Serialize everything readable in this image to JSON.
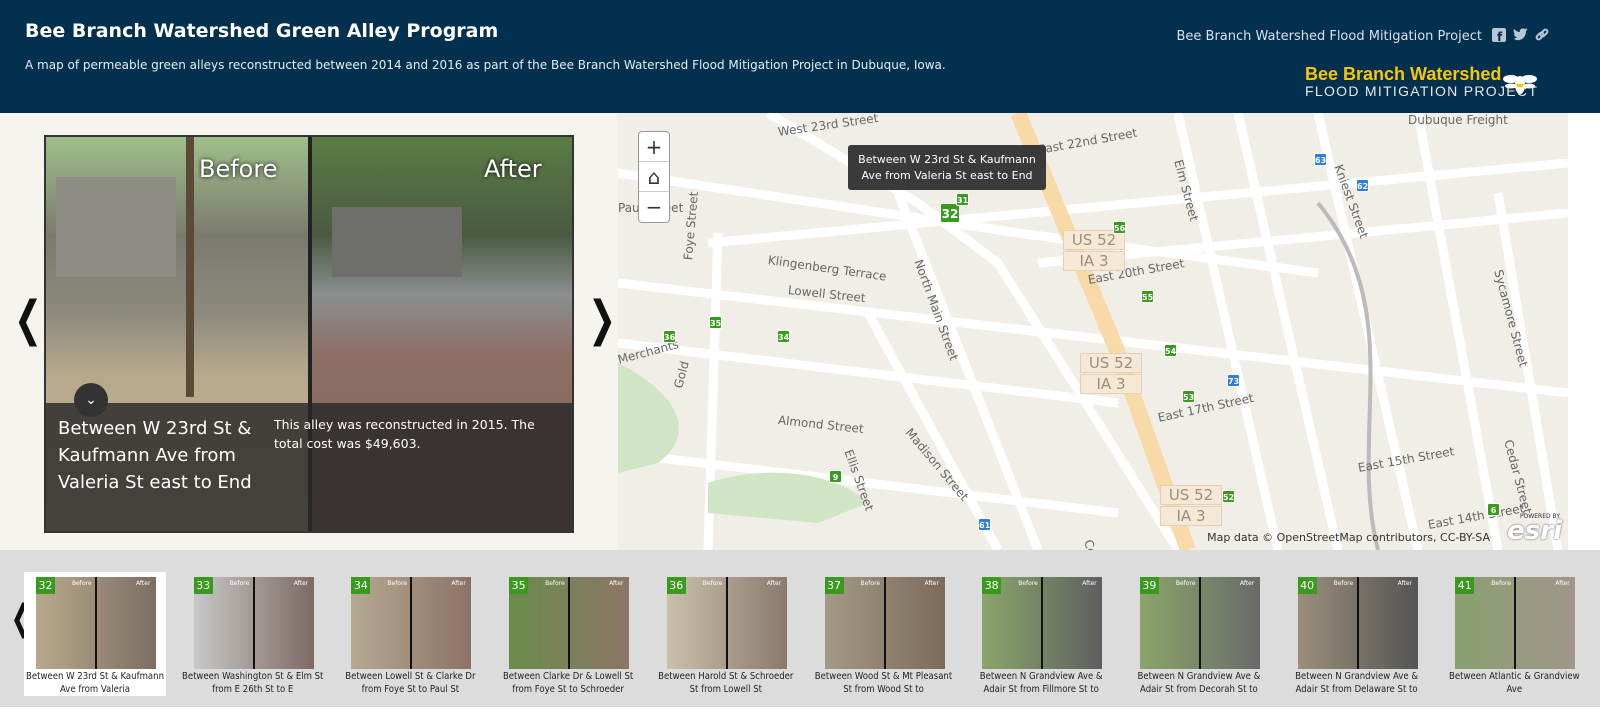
{
  "header": {
    "title": "Bee Branch Watershed Green Alley Program",
    "subtitle": "A map of permeable green alleys reconstructed between 2014 and 2016 as part of the Bee Branch Watershed Flood Mitigation Project in Dubuque, Iowa.",
    "link": "Bee Branch Watershed Flood Mitigation Project",
    "social": [
      "facebook-icon",
      "twitter-icon",
      "link-icon"
    ],
    "logo_line1": "Bee Branch Watershed",
    "logo_line2": "FLOOD MITIGATION PROJECT"
  },
  "feature": {
    "before_label": "Before",
    "after_label": "After",
    "title": "Between W 23rd St & Kaufmann Ave from Valeria St east to End",
    "description": "This alley was reconstructed in 2015. The total cost was $49,603."
  },
  "map": {
    "zoom_in": "+",
    "home": "⌂",
    "zoom_out": "−",
    "tooltip": "Between W 23rd St & Kaufmann Ave from Valeria St east to End",
    "attribution": "Map data © OpenStreetMap contributors, CC-BY-SA",
    "esri_powered": "POWERED BY",
    "esri": "esri",
    "streets": [
      "West 23rd Street",
      "East 22nd Street",
      "Elm Street",
      "Kniest Street",
      "Klingenberg Terrace",
      "Lowell Street",
      "North Main Street",
      "Foye Street",
      "East 20th Street",
      "Merchants",
      "Gold",
      "Almond Street",
      "Ellis Street",
      "Madison Street",
      "East 17th Street",
      "East 15th Street",
      "Sycamore Street",
      "Cedar Street",
      "East 14th Street",
      "Central",
      "Dubuque Freight",
      "Paul Street"
    ],
    "shields": [
      "US 52",
      "IA 3",
      "US 52",
      "IA 3",
      "US 52",
      "IA 3"
    ],
    "markers": [
      {
        "n": "32",
        "color": "green"
      },
      {
        "n": "31",
        "color": "green"
      },
      {
        "n": "63",
        "color": "blue"
      },
      {
        "n": "62",
        "color": "blue"
      },
      {
        "n": "56",
        "color": "green"
      },
      {
        "n": "55",
        "color": "green"
      },
      {
        "n": "36",
        "color": "green"
      },
      {
        "n": "35",
        "color": "green"
      },
      {
        "n": "34",
        "color": "green"
      },
      {
        "n": "54",
        "color": "green"
      },
      {
        "n": "73",
        "color": "blue"
      },
      {
        "n": "53",
        "color": "green"
      },
      {
        "n": "9",
        "color": "green"
      },
      {
        "n": "52",
        "color": "green"
      },
      {
        "n": "61",
        "color": "blue"
      },
      {
        "n": "6",
        "color": "green"
      }
    ]
  },
  "colors": {
    "header": "#04304f",
    "green_marker": "#3a9a1e",
    "blue_marker": "#2b7de0",
    "logo_yellow": "#f7c800"
  },
  "carousel": {
    "items": [
      {
        "n": "32",
        "caption": "Between W 23rd St & Kaufmann Ave from Valeria",
        "active": true
      },
      {
        "n": "33",
        "caption": "Between Washington St & Elm St from E 26th St to E"
      },
      {
        "n": "34",
        "caption": "Between Lowell St & Clarke Dr from Foye St to Paul St"
      },
      {
        "n": "35",
        "caption": "Between Clarke Dr & Lowell St from Foye St to Schroeder"
      },
      {
        "n": "36",
        "caption": "Between Harold St & Schroeder St from Lowell St"
      },
      {
        "n": "37",
        "caption": "Between Wood St & Mt Pleasant St from Wood St to"
      },
      {
        "n": "38",
        "caption": "Between N Grandview Ave & Adair St from Fillmore St to"
      },
      {
        "n": "39",
        "caption": "Between N Grandview Ave & Adair St from Decorah St to"
      },
      {
        "n": "40",
        "caption": "Between N Grandview Ave & Adair St from Delaware St to"
      },
      {
        "n": "41",
        "caption": "Between Atlantic & Grandview Ave"
      }
    ],
    "thumb_before": "Before",
    "thumb_after": "After",
    "prev": "‹",
    "next": "›"
  }
}
